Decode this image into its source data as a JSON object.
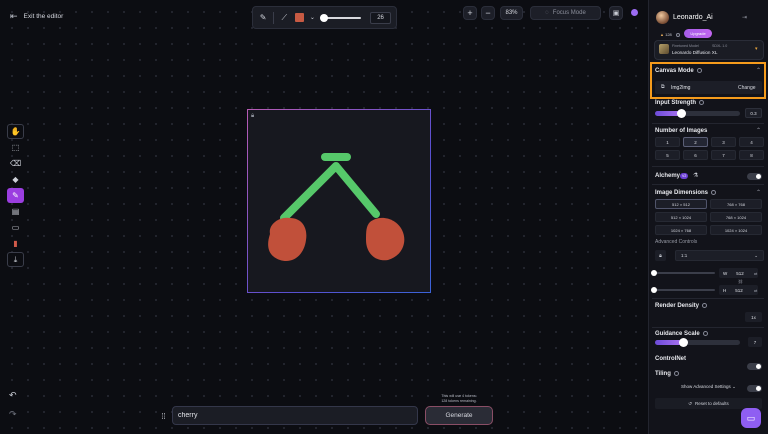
{
  "topbar": {
    "exit_label": "Exit the editor",
    "brush_size": "26",
    "zoom_level": "83%",
    "focus_mode_label": "Focus Mode",
    "brush_color": "#c75a43"
  },
  "tools": [
    "hand-icon",
    "select-icon",
    "eraser-icon",
    "fill-icon",
    "pencil-icon",
    "image-icon",
    "layer-icon",
    "delete-icon",
    "download-icon"
  ],
  "prompt": {
    "value": "cherry",
    "token_info_line1": "This will use 4 tokens.",
    "token_info_line2": "128 tokens remaining.",
    "generate_label": "Generate"
  },
  "panel": {
    "username": "Leonardo_Ai",
    "tokens": "128",
    "upgrade_label": "Upgrade",
    "model_label": "Finetuned Model",
    "model_sub": "SDXL 1.0",
    "model_name": "Leonardo Diffusion XL",
    "canvas_mode": {
      "label": "Canvas Mode",
      "value": "Img2Img",
      "change_label": "Change"
    },
    "input_strength": {
      "label": "Input Strength",
      "value": "0.3",
      "fraction": 0.3
    },
    "number_of_images": {
      "label": "Number of Images",
      "options": [
        "1",
        "2",
        "3",
        "4",
        "5",
        "6",
        "7",
        "8"
      ],
      "selected": "2"
    },
    "alchemy": {
      "label": "Alchemy",
      "badge": "V2"
    },
    "image_dimensions": {
      "label": "Image Dimensions",
      "options": [
        "512 × 512",
        "768 × 768",
        "512 × 1024",
        "768 × 1024",
        "1024 × 768",
        "1024 × 1024"
      ],
      "advanced_controls_label": "Advanced Controls",
      "ratio": "1:1",
      "width_label": "W",
      "width": "512",
      "height_label": "H",
      "height": "512"
    },
    "render_density": {
      "label": "Render Density",
      "value": "1x"
    },
    "guidance_scale": {
      "label": "Guidance Scale",
      "value": "7"
    },
    "controlnet_label": "ControlNet",
    "tiling_label": "Tiling",
    "advanced_settings_label": "Show Advanced Settings",
    "reset_label": "Reset to defaults"
  }
}
